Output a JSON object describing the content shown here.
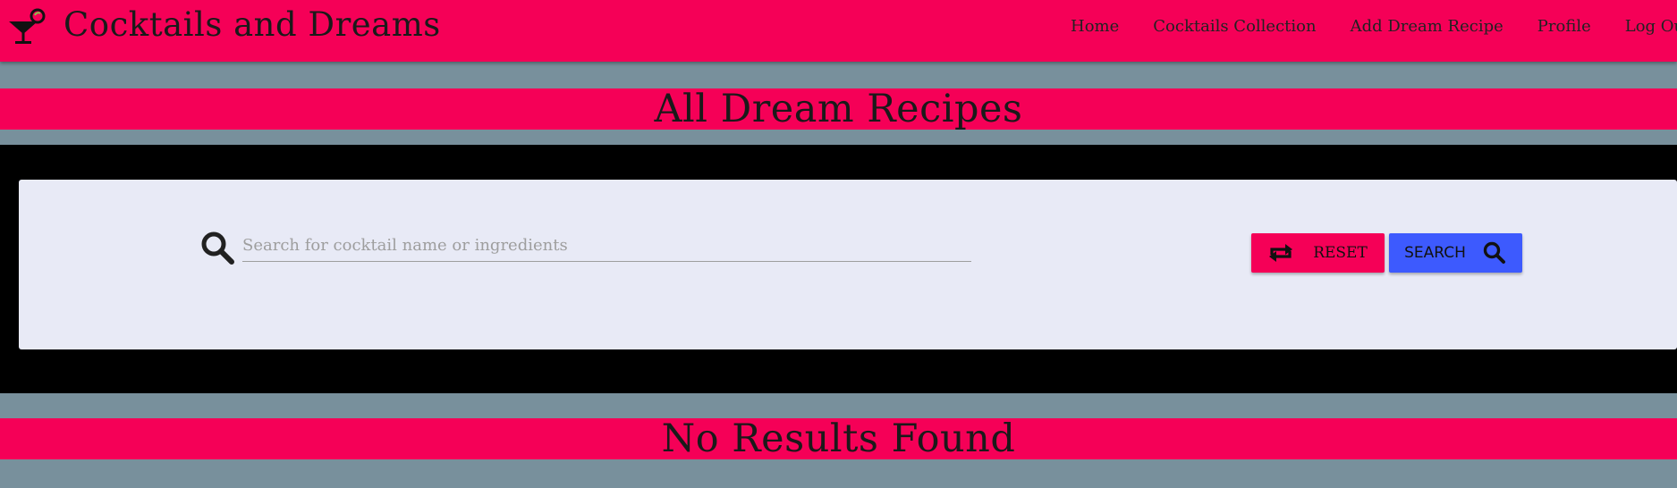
{
  "brand": {
    "title": "Cocktails and Dreams",
    "icon": "cocktail-glass-icon"
  },
  "nav": {
    "items": [
      {
        "label": "Home"
      },
      {
        "label": "Cocktails Collection"
      },
      {
        "label": "Add Dream Recipe"
      },
      {
        "label": "Profile"
      },
      {
        "label": "Log Out"
      }
    ]
  },
  "page": {
    "heading": "All Dream Recipes"
  },
  "search": {
    "placeholder": "Search for cocktail name or ingredients",
    "value": "",
    "icon": "search-icon",
    "reset_label": "RESET",
    "reset_icon": "repeat-icon",
    "search_label": "SEARCH",
    "search_button_icon": "search-icon"
  },
  "results": {
    "message": "No Results Found"
  },
  "colors": {
    "accent": "#f50057",
    "background": "#78909c",
    "search_button": "#3d5afe",
    "card": "#e8eaf6"
  }
}
